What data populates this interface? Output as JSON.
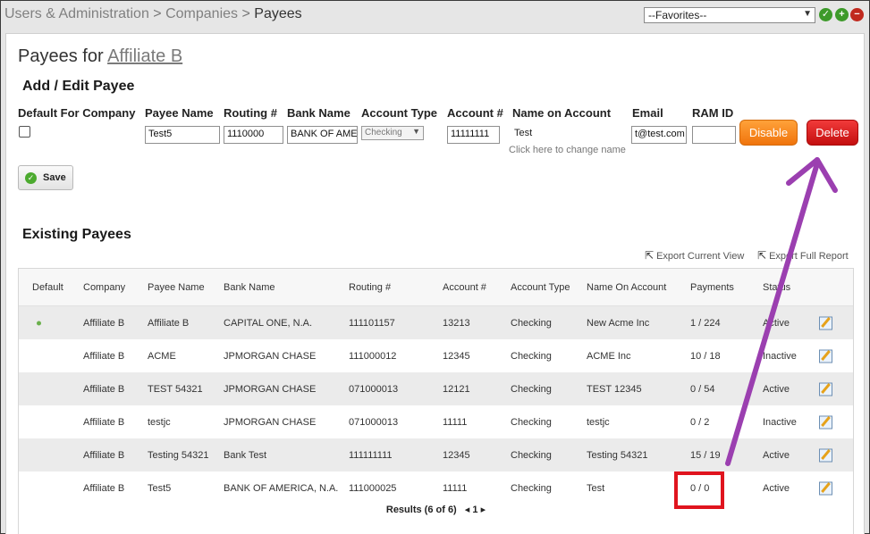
{
  "breadcrumb": {
    "items": [
      "Users & Administration",
      "Companies",
      "Payees"
    ],
    "separator": ">"
  },
  "favorites": {
    "selected": "--Favorites--"
  },
  "page": {
    "title_prefix": "Payees for",
    "title_link": "Affiliate B"
  },
  "form": {
    "heading": "Add / Edit Payee",
    "labels": {
      "default": "Default For Company",
      "payee_name": "Payee Name",
      "routing": "Routing #",
      "bank_name": "Bank Name",
      "account_type": "Account Type",
      "account_num": "Account #",
      "name_on_account": "Name on Account",
      "email": "Email",
      "ram_id": "RAM ID"
    },
    "values": {
      "payee_name": "Test5",
      "routing": "1110000",
      "bank_name": "BANK OF AME",
      "account_type": "Checking",
      "account_num": "11111111",
      "name_on_account": "Test",
      "change_name_link": "Click here to change name",
      "email": "t@test.com",
      "ram_id": ""
    },
    "buttons": {
      "disable": "Disable",
      "delete": "Delete",
      "save": "Save"
    }
  },
  "existing": {
    "heading": "Existing Payees",
    "export_current": "Export Current View",
    "export_full": "Export Full Report",
    "columns": [
      "Default",
      "Company",
      "Payee Name",
      "Bank Name",
      "Routing #",
      "Account #",
      "Account Type",
      "Name On Account",
      "Payments",
      "Status"
    ],
    "rows": [
      {
        "default": true,
        "company": "Affiliate B",
        "payee": "Affiliate B",
        "bank": "CAPITAL ONE, N.A.",
        "routing": "111101157",
        "account": "13213",
        "type": "Checking",
        "name": "New Acme Inc",
        "payments": "1 / 224",
        "status": "Active"
      },
      {
        "default": false,
        "company": "Affiliate B",
        "payee": "ACME",
        "bank": "JPMORGAN CHASE",
        "routing": "111000012",
        "account": "12345",
        "type": "Checking",
        "name": "ACME Inc",
        "payments": "10 / 18",
        "status": "Inactive"
      },
      {
        "default": false,
        "company": "Affiliate B",
        "payee": "TEST 54321",
        "bank": "JPMORGAN CHASE",
        "routing": "071000013",
        "account": "12121",
        "type": "Checking",
        "name": "TEST 12345",
        "payments": "0 / 54",
        "status": "Active"
      },
      {
        "default": false,
        "company": "Affiliate B",
        "payee": "testjc",
        "bank": "JPMORGAN CHASE",
        "routing": "071000013",
        "account": "11111",
        "type": "Checking",
        "name": "testjc",
        "payments": "0 / 2",
        "status": "Inactive"
      },
      {
        "default": false,
        "company": "Affiliate B",
        "payee": "Testing 54321",
        "bank": "Bank Test",
        "routing": "111111111",
        "account": "12345",
        "type": "Checking",
        "name": "Testing 54321",
        "payments": "15 / 19",
        "status": "Active"
      },
      {
        "default": false,
        "company": "Affiliate B",
        "payee": "Test5",
        "bank": "BANK OF AMERICA, N.A.",
        "routing": "111000025",
        "account": "11111",
        "type": "Checking",
        "name": "Test",
        "payments": "0 / 0",
        "status": "Active"
      }
    ],
    "results_label": "Results (6 of 6)",
    "page_number": "1"
  },
  "annotation_colors": {
    "box": "#e0141e",
    "arrow": "#9b3fb0"
  }
}
